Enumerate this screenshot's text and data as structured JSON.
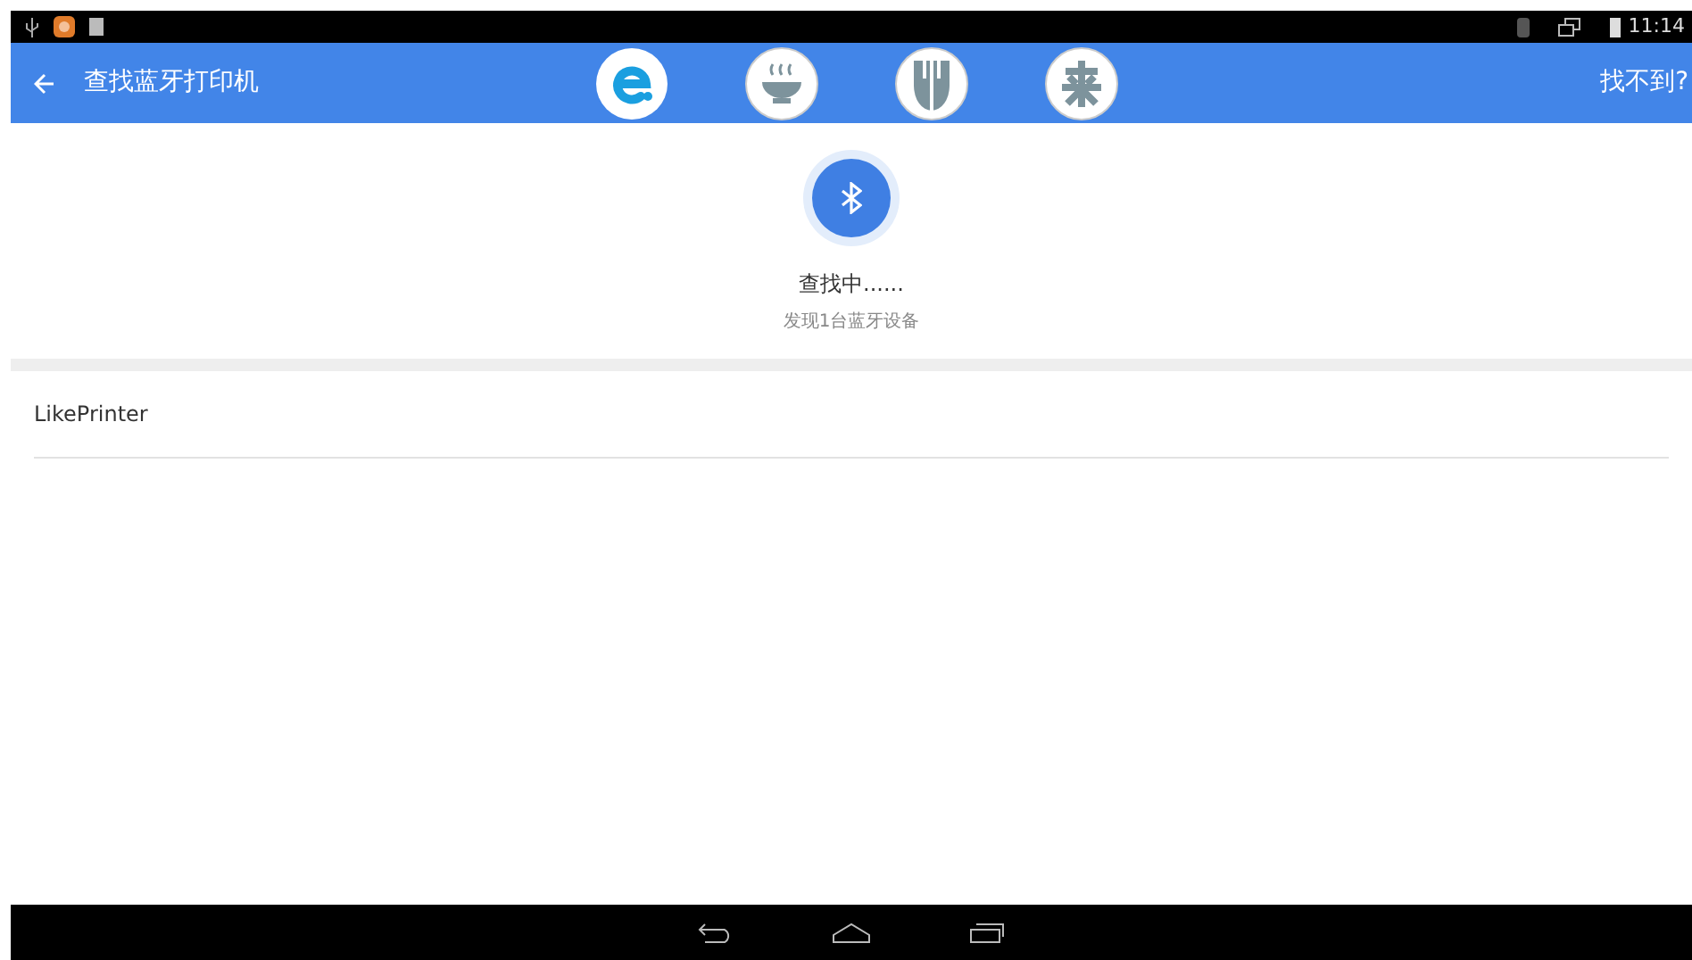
{
  "status_bar": {
    "time": "11:14"
  },
  "app_bar": {
    "title": "查找蓝牙打印机",
    "action": "找不到?"
  },
  "scan": {
    "status": "查找中......",
    "found": "发现1台蓝牙设备"
  },
  "devices": [
    {
      "name": "LikePrinter"
    }
  ]
}
